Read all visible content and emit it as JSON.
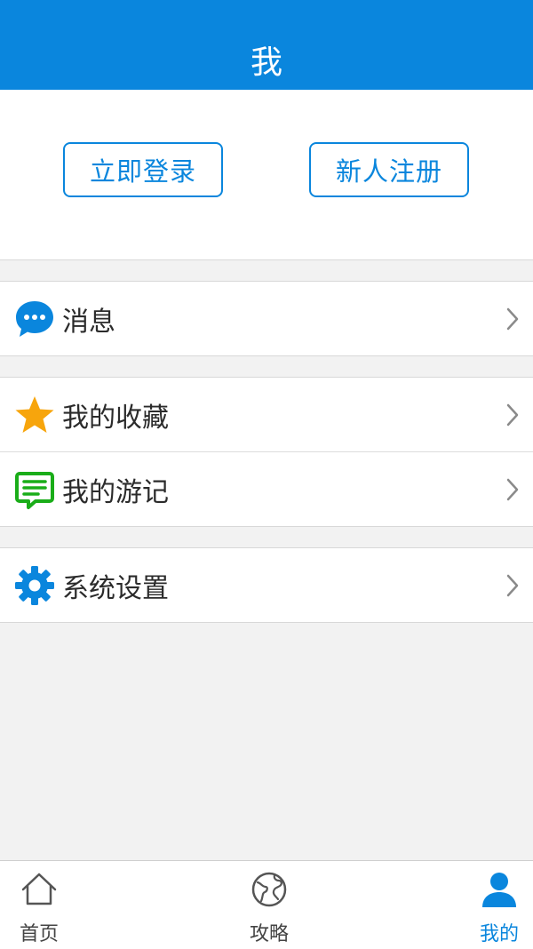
{
  "header": {
    "title": "我"
  },
  "auth": {
    "login_label": "立即登录",
    "register_label": "新人注册"
  },
  "menu": {
    "messages": {
      "label": "消息",
      "icon": "message-bubble-icon",
      "color": "#0a86dd"
    },
    "favorites": {
      "label": "我的收藏",
      "icon": "star-icon",
      "color": "#f7a50c"
    },
    "travel_notes": {
      "label": "我的游记",
      "icon": "note-icon",
      "color": "#1aad19"
    },
    "settings": {
      "label": "系统设置",
      "icon": "gear-icon",
      "color": "#0a86dd"
    }
  },
  "tabbar": {
    "items": [
      {
        "label": "首页",
        "icon": "home-icon",
        "active": false
      },
      {
        "label": "攻略",
        "icon": "globe-icon",
        "active": false
      },
      {
        "label": "我的",
        "icon": "person-icon",
        "active": true
      }
    ]
  },
  "colors": {
    "primary": "#0a86dd",
    "background": "#f2f2f2",
    "star": "#f7a50c",
    "note": "#1aad19"
  }
}
